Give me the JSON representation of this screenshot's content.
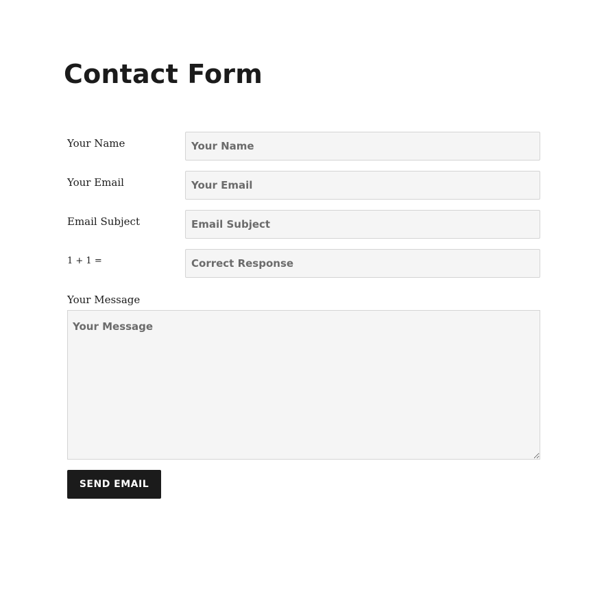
{
  "page": {
    "title": "Contact Form"
  },
  "form": {
    "fields": [
      {
        "label": "Your Name",
        "placeholder": "Your Name",
        "value": ""
      },
      {
        "label": "Your Email",
        "placeholder": "Your Email",
        "value": ""
      },
      {
        "label": "Email Subject",
        "placeholder": "Email Subject",
        "value": ""
      },
      {
        "label": "1 + 1 =",
        "placeholder": "Correct Response",
        "value": ""
      }
    ],
    "message": {
      "label": "Your Message",
      "placeholder": "Your Message",
      "value": ""
    },
    "submit_label": "SEND EMAIL"
  }
}
